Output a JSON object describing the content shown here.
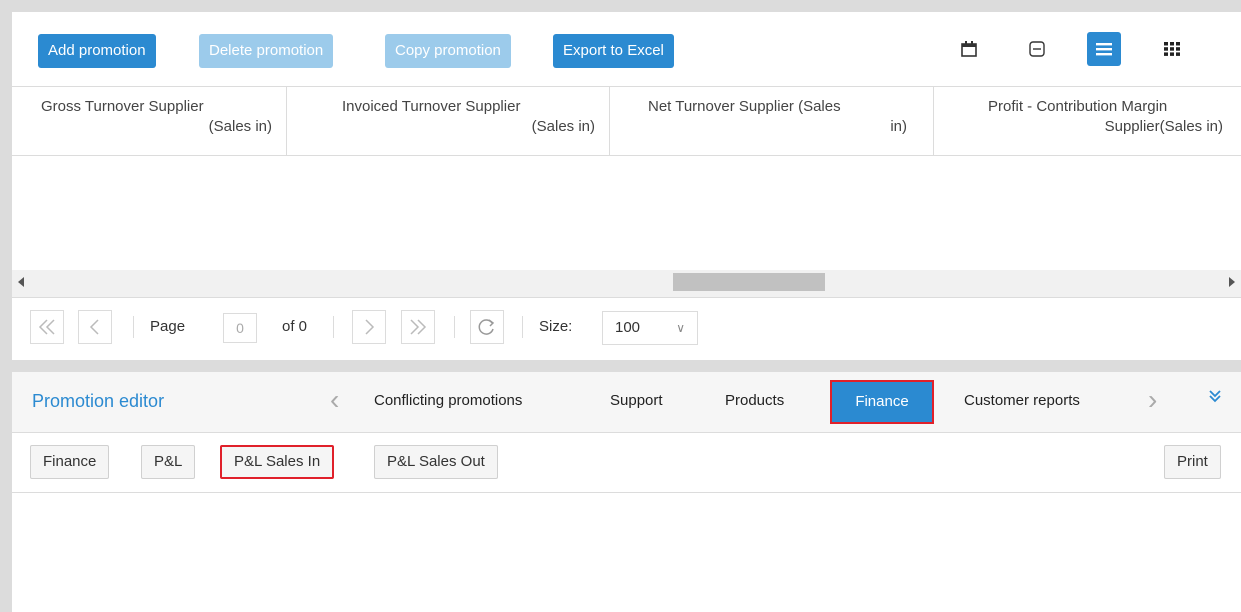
{
  "toolbar": {
    "add_label": "Add promotion",
    "delete_label": "Delete promotion",
    "copy_label": "Copy promotion",
    "export_label": "Export to Excel",
    "icons": [
      "calendar-icon",
      "collapse-row-icon",
      "list-view-icon",
      "grid-view-icon"
    ]
  },
  "grid": {
    "columns": [
      {
        "line1": "Gross Turnover Supplier",
        "line2": "(Sales in)"
      },
      {
        "line1": "Invoiced Turnover Supplier",
        "line2": "(Sales in)"
      },
      {
        "line1": "Net Turnover Supplier (Sales",
        "line2": "in)"
      },
      {
        "line1": "Profit - Contribution Margin",
        "line2": "Supplier(Sales in)"
      }
    ]
  },
  "pager": {
    "page_label": "Page",
    "page_value": "0",
    "of_label": "of 0",
    "size_label": "Size:",
    "size_value": "100"
  },
  "editor": {
    "title": "Promotion editor",
    "tabs": [
      "Conflicting promotions",
      "Support",
      "Products",
      "Finance",
      "Customer reports"
    ],
    "active_tab": "Finance"
  },
  "subtabs": {
    "items": [
      "Finance",
      "P&L",
      "P&L Sales In",
      "P&L Sales Out"
    ],
    "print_label": "Print"
  },
  "colors": {
    "accent": "#2b8ad1",
    "highlight": "#e0202a"
  }
}
